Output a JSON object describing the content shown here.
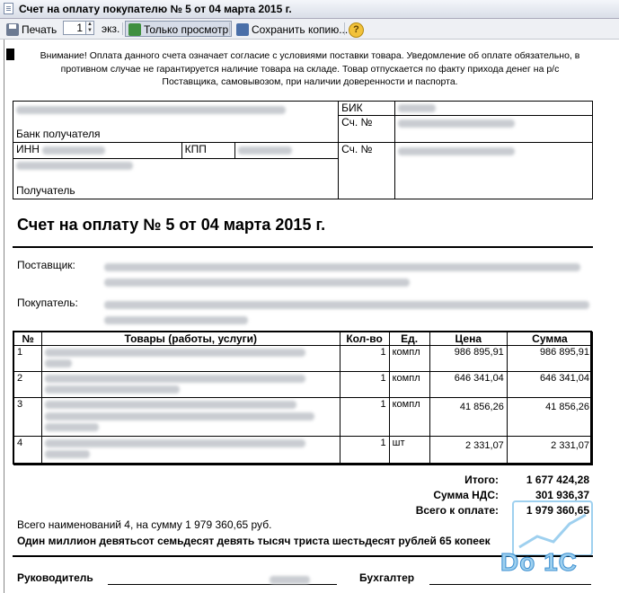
{
  "window": {
    "title": "Счет на оплату покупателю № 5 от 04 марта 2015 г."
  },
  "toolbar": {
    "print_label": "Печать",
    "copies_value": "1",
    "copies_unit": "экз.",
    "view_only_label": "Только просмотр",
    "save_copy_label": "Сохранить копию...",
    "help_label": "?"
  },
  "warning": "Внимание! Оплата данного счета означает согласие с условиями поставки товара. Уведомление об оплате обязательно, в противном случае не гарантируется наличие товара на складе. Товар отпускается по факту прихода денег на р/с Поставщика, самовывозом, при наличии доверенности и паспорта.",
  "bank": {
    "bank_label": "Банк получателя",
    "bik_label": "БИК",
    "account_label": "Сч. №",
    "inn_label": "ИНН",
    "kpp_label": "КПП",
    "account2_label": "Сч. №",
    "recipient_label": "Получатель"
  },
  "invoice_title": "Счет на оплату № 5 от 04 марта 2015 г.",
  "supplier_label": "Поставщик:",
  "buyer_label": "Покупатель:",
  "goods": {
    "headers": [
      "№",
      "Товары (работы, услуги)",
      "Кол-во",
      "Ед.",
      "Цена",
      "Сумма"
    ],
    "rows": [
      {
        "n": "1",
        "qty": "1",
        "unit": "компл",
        "price": "986 895,91",
        "sum": "986 895,91"
      },
      {
        "n": "2",
        "qty": "1",
        "unit": "компл",
        "price": "646 341,04",
        "sum": "646 341,04"
      },
      {
        "n": "3",
        "qty": "1",
        "unit": "компл",
        "price": "41 856,26",
        "sum": "41 856,26"
      },
      {
        "n": "4",
        "qty": "1",
        "unit": "шт",
        "price": "2 331,07",
        "sum": "2 331,07"
      }
    ]
  },
  "totals": {
    "total_label": "Итого:",
    "total_value": "1 677 424,28",
    "vat_label": "Сумма НДС:",
    "vat_value": "301 936,37",
    "due_label": "Всего к оплате:",
    "due_value": "1 979 360,65"
  },
  "summary": "Всего наименований 4, на сумму 1 979 360,65 руб.",
  "amount_words": "Один миллион девятьсот семьдесят девять тысяч триста шестьдесят рублей 65 копеек",
  "signatures": {
    "director_label": "Руководитель",
    "accountant_label": "Бухгалтер"
  },
  "watermark": "Do 1C",
  "colors": {
    "watermark": "#3a8ed0",
    "titlebar": "#d9dee8"
  }
}
